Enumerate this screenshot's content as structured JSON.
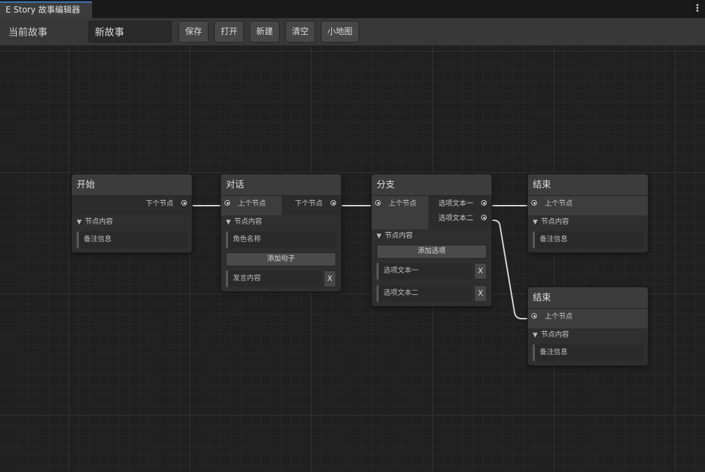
{
  "window": {
    "tab_title": "E Story 故事编辑器",
    "menu_icon": "vertical-ellipsis-icon"
  },
  "toolbar": {
    "current_story_label": "当前故事",
    "story_name_value": "新故事",
    "buttons": {
      "save": "保存",
      "open": "打开",
      "new": "新建",
      "clear": "清空",
      "minimap": "小地图"
    }
  },
  "colors": {
    "accent": "#3a79bb",
    "background": "#202020",
    "node_body": "#2f2f2f",
    "node_header": "#3c3c3c",
    "edge": "#d8d8d8"
  },
  "nodes": {
    "start": {
      "title": "开始",
      "out_port": "下个节点",
      "content_header": "节点内容",
      "remark_placeholder": "备注信息"
    },
    "dialogue": {
      "title": "对话",
      "in_port": "上个节点",
      "out_port": "下个节点",
      "content_header": "节点内容",
      "role_name_placeholder": "角色名称",
      "add_sentence_label": "添加句子",
      "speech_placeholder": "发言内容",
      "remove_label": "X"
    },
    "branch": {
      "title": "分支",
      "in_port": "上个节点",
      "out_ports": [
        "选项文本一",
        "选项文本二"
      ],
      "content_header": "节点内容",
      "add_option_label": "添加选项",
      "options": [
        "选项文本一",
        "选项文本二"
      ],
      "remove_label": "X"
    },
    "end_1": {
      "title": "结束",
      "in_port": "上个节点",
      "content_header": "节点内容",
      "remark_placeholder": "备注信息"
    },
    "end_2": {
      "title": "结束",
      "in_port": "上个节点",
      "content_header": "节点内容",
      "remark_placeholder": "备注信息"
    }
  }
}
